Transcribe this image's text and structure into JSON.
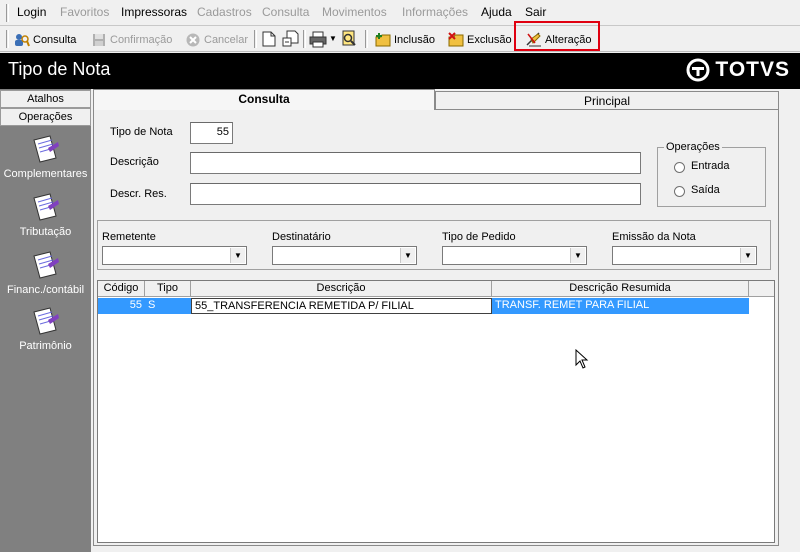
{
  "menu": {
    "items": [
      {
        "label": "Login",
        "state": "enabled"
      },
      {
        "label": "Favoritos",
        "state": "disabled"
      },
      {
        "label": "Impressoras",
        "state": "enabled"
      },
      {
        "label": "Cadastros",
        "state": "disabled"
      },
      {
        "label": "Consulta",
        "state": "disabled"
      },
      {
        "label": "Movimentos",
        "state": "disabled"
      },
      {
        "label": "Informações",
        "state": "disabled"
      },
      {
        "label": "Ajuda",
        "state": "enabled"
      },
      {
        "label": "Sair",
        "state": "enabled"
      }
    ]
  },
  "toolbar": {
    "consulta": "Consulta",
    "confirmacao": "Confirmação",
    "cancelar": "Cancelar",
    "inclusao": "Inclusão",
    "exclusao": "Exclusão",
    "alteracao": "Alteração",
    "highlight_color": "#e00010"
  },
  "window": {
    "title": "Tipo de Nota",
    "brand": "TOTVS"
  },
  "sidebar": {
    "tabs": [
      "Atalhos",
      "Operações"
    ],
    "items": [
      "Complementares",
      "Tributação",
      "Financ./contábil",
      "Patrimônio"
    ]
  },
  "tabs": {
    "consulta": "Consulta",
    "principal": "Principal"
  },
  "form": {
    "tipo_nota_label": "Tipo de Nota",
    "tipo_nota_value": "55",
    "descricao_label": "Descrição",
    "descricao_value": "",
    "descr_res_label": "Descr. Res.",
    "descr_res_value": "",
    "operacoes_title": "Operações",
    "entrada_label": "Entrada",
    "saida_label": "Saída"
  },
  "filters": {
    "remetente": "Remetente",
    "destinatario": "Destinatário",
    "tipo_pedido": "Tipo de Pedido",
    "emissao_nota": "Emissão da Nota"
  },
  "grid": {
    "columns": [
      "Código",
      "Tipo",
      "Descrição",
      "Descrição Resumida"
    ],
    "rows": [
      {
        "codigo": "55",
        "tipo": "S",
        "descricao": "55_TRANSFERENCIA REMETIDA P/ FILIAL",
        "descricao_resumida": "TRANSF. REMET PARA FILIAL"
      }
    ],
    "selection_color": "#3399ff"
  }
}
